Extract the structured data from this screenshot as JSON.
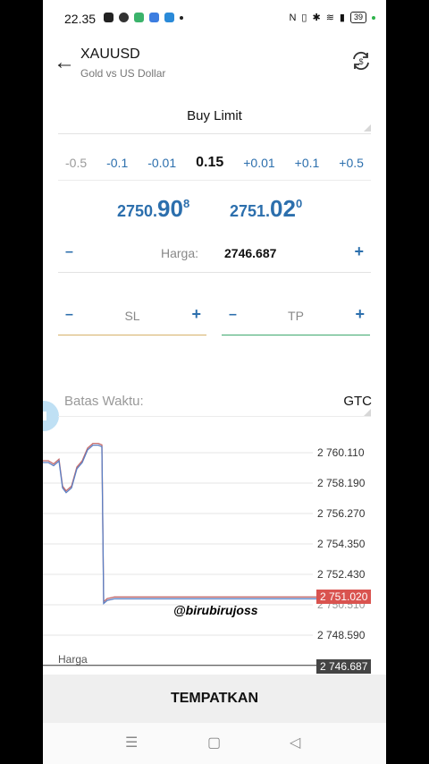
{
  "status_bar": {
    "time": "22.35",
    "battery": "39"
  },
  "header": {
    "symbol": "XAUUSD",
    "description": "Gold vs US Dollar"
  },
  "order": {
    "type": "Buy Limit"
  },
  "volume": {
    "steps": [
      "-0.5",
      "-0.1",
      "-0.01",
      "0.15",
      "+0.01",
      "+0.1",
      "+0.5"
    ],
    "current": "0.15"
  },
  "quotes": {
    "bid": {
      "lead": "2750.",
      "big": "90",
      "small": "8"
    },
    "ask": {
      "lead": "2751.",
      "big": "02",
      "small": "0"
    }
  },
  "price_field": {
    "minus": "–",
    "plus": "+",
    "label": "Harga:",
    "value": "2746.687"
  },
  "stop_loss": {
    "minus": "–",
    "plus": "+",
    "label": "SL"
  },
  "take_profit": {
    "minus": "–",
    "plus": "+",
    "label": "TP"
  },
  "expiry": {
    "label": "Batas Waktu:",
    "value": "GTC"
  },
  "chart_data": {
    "type": "line",
    "y_ticks": [
      "2 760.110",
      "2 758.190",
      "2 756.270",
      "2 754.350",
      "2 752.430",
      "2 750.510",
      "2 748.590"
    ],
    "current_price_tag": "2 751.020",
    "order_price_tag": "2 746.687",
    "order_line_label": "Harga",
    "ylim": [
      2746.687,
      2760.11
    ],
    "series": [
      {
        "values": [
          2759.6,
          2759.6,
          2759.4,
          2759.7,
          2758.0,
          2757.7,
          2758.0,
          2759.2,
          2759.6,
          2760.4,
          2760.7,
          2760.7,
          2760.6,
          2750.7,
          2750.9,
          2751.0,
          2751.0,
          2751.0,
          2751.0,
          2751.0,
          2751.0,
          2751.0,
          2751.0
        ]
      }
    ],
    "colors": {
      "bid": "#c46a6a",
      "ask": "#5a7fc4",
      "grid": "#e6e6e6"
    },
    "watermark": "@birubirujoss"
  },
  "actions": {
    "submit": "TEMPATKAN"
  },
  "navigation": {
    "menu": "☰",
    "home": "▢",
    "back": "◁"
  }
}
